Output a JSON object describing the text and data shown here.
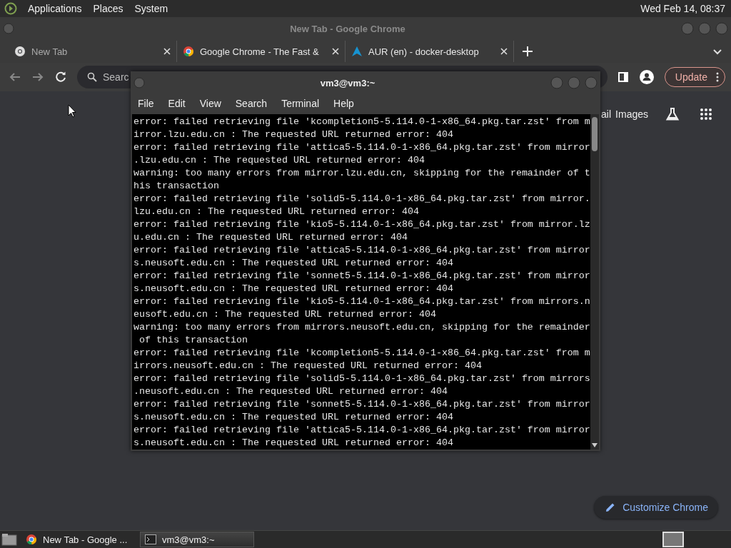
{
  "top_panel": {
    "menus": [
      "Applications",
      "Places",
      "System"
    ],
    "clock": "Wed Feb 14, 08:37"
  },
  "browser": {
    "title": "New Tab - Google Chrome",
    "tabs": [
      {
        "label": "New Tab",
        "selected": true,
        "kind": "newtab"
      },
      {
        "label": "Google Chrome - The Fast &",
        "selected": false,
        "kind": "chrome"
      },
      {
        "label": "AUR (en) - docker-desktop",
        "selected": false,
        "kind": "aur"
      }
    ],
    "search": {
      "placeholder": "Searc"
    },
    "update_button": "Update",
    "links": [
      "ail",
      "Images"
    ],
    "customize_button": "Customize Chrome"
  },
  "terminal": {
    "title": "vm3@vm3:~",
    "menu": [
      "File",
      "Edit",
      "View",
      "Search",
      "Terminal",
      "Help"
    ],
    "lines": [
      "error: failed retrieving file 'kcompletion5-5.114.0-1-x86_64.pkg.tar.zst' from m",
      "irror.lzu.edu.cn : The requested URL returned error: 404",
      "error: failed retrieving file 'attica5-5.114.0-1-x86_64.pkg.tar.zst' from mirror",
      ".lzu.edu.cn : The requested URL returned error: 404",
      "warning: too many errors from mirror.lzu.edu.cn, skipping for the remainder of t",
      "his transaction",
      "error: failed retrieving file 'solid5-5.114.0-1-x86_64.pkg.tar.zst' from mirror.",
      "lzu.edu.cn : The requested URL returned error: 404",
      "error: failed retrieving file 'kio5-5.114.0-1-x86_64.pkg.tar.zst' from mirror.lz",
      "u.edu.cn : The requested URL returned error: 404",
      "error: failed retrieving file 'attica5-5.114.0-1-x86_64.pkg.tar.zst' from mirror",
      "s.neusoft.edu.cn : The requested URL returned error: 404",
      "error: failed retrieving file 'sonnet5-5.114.0-1-x86_64.pkg.tar.zst' from mirror",
      "s.neusoft.edu.cn : The requested URL returned error: 404",
      "error: failed retrieving file 'kio5-5.114.0-1-x86_64.pkg.tar.zst' from mirrors.n",
      "eusoft.edu.cn : The requested URL returned error: 404",
      "warning: too many errors from mirrors.neusoft.edu.cn, skipping for the remainder",
      " of this transaction",
      "error: failed retrieving file 'kcompletion5-5.114.0-1-x86_64.pkg.tar.zst' from m",
      "irrors.neusoft.edu.cn : The requested URL returned error: 404",
      "error: failed retrieving file 'solid5-5.114.0-1-x86_64.pkg.tar.zst' from mirrors",
      ".neusoft.edu.cn : The requested URL returned error: 404",
      "error: failed retrieving file 'sonnet5-5.114.0-1-x86_64.pkg.tar.zst' from mirror",
      "s.neusoft.edu.cn : The requested URL returned error: 404",
      "error: failed retrieving file 'attica5-5.114.0-1-x86_64.pkg.tar.zst' from mirror",
      "s.neusoft.edu.cn : The requested URL returned error: 404"
    ]
  },
  "taskbar": {
    "items": [
      {
        "label": "New Tab - Google ...",
        "selected": false,
        "kind": "chrome"
      },
      {
        "label": "vm3@vm3:~",
        "selected": true,
        "kind": "terminal"
      }
    ]
  }
}
